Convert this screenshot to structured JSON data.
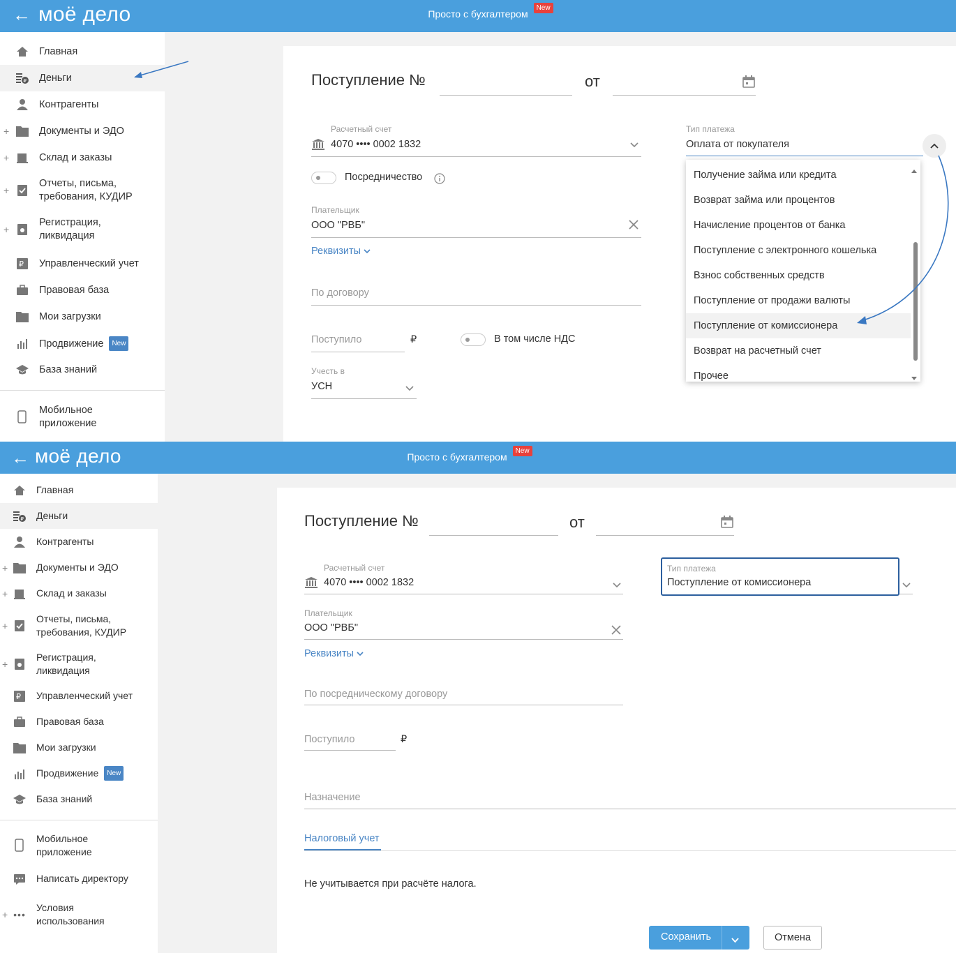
{
  "header": {
    "back_icon": "arrow-left-icon",
    "logo": "моё дело",
    "center_text": "Просто с бухгалтером",
    "new_badge": "New",
    "color": "#4a9fdd"
  },
  "sidebar": {
    "items": [
      {
        "label": "Главная",
        "icon": "home-icon"
      },
      {
        "label": "Деньги",
        "icon": "money-icon"
      },
      {
        "label": "Контрагенты",
        "icon": "person-icon"
      },
      {
        "label": "Документы и ЭДО",
        "icon": "folder-icon"
      },
      {
        "label": "Склад и заказы",
        "icon": "warehouse-icon"
      },
      {
        "label": "Отчеты, письма, требования, КУДИР",
        "icon": "report-icon"
      },
      {
        "label": "Регистрация, ликвидация",
        "icon": "registration-icon"
      },
      {
        "label": "Управленческий учет",
        "icon": "ruble-chart-icon"
      },
      {
        "label": "Правовая база",
        "icon": "briefcase-icon"
      },
      {
        "label": "Мои загрузки",
        "icon": "folder-icon"
      },
      {
        "label": "Продвижение",
        "icon": "chart-icon",
        "badge": "New"
      },
      {
        "label": "База знаний",
        "icon": "graduation-cap-icon"
      }
    ],
    "mobile": "Мобильное приложение",
    "write_director": "Написать директору",
    "terms": "Условия использования"
  },
  "top_form": {
    "title": "Поступление №",
    "from": "от",
    "account_label": "Расчетный счет",
    "account_value": "4070 •••• 0002 1832",
    "mediation_label": "Посредничество",
    "payer_label": "Плательщик",
    "payer_value": "ООО \"РВБ\"",
    "requisites": "Реквизиты",
    "contract_placeholder": "По договору",
    "received_placeholder": "Поступило",
    "currency": "₽",
    "vat_label": "В том числе НДС",
    "account_in_label": "Учесть в",
    "account_in_value": "УСН",
    "payment_type_label": "Тип платежа",
    "payment_type_value": "Оплата от покупателя",
    "dropdown_items": [
      "Получение займа или кредита",
      "Возврат займа или процентов",
      "Начисление процентов от банка",
      "Поступление с электронного кошелька",
      "Взнос собственных средств",
      "Поступление от продажи валюты",
      "Поступление от комиссионера",
      "Возврат на расчетный счет",
      "Прочее"
    ]
  },
  "bottom_form": {
    "title": "Поступление №",
    "from": "от",
    "account_label": "Расчетный счет",
    "account_value": "4070 •••• 0002 1832",
    "payment_type_label": "Тип платежа",
    "payment_type_value": "Поступление от комиссионера",
    "payer_label": "Плательщик",
    "payer_value": "ООО \"РВБ\"",
    "requisites": "Реквизиты",
    "contract_placeholder": "По посредническому договору",
    "received_placeholder": "Поступило",
    "currency": "₽",
    "purpose_placeholder": "Назначение",
    "tax_tab": "Налоговый учет",
    "tax_note": "Не учитывается при расчёте налога.",
    "save": "Сохранить",
    "cancel": "Отмена"
  }
}
